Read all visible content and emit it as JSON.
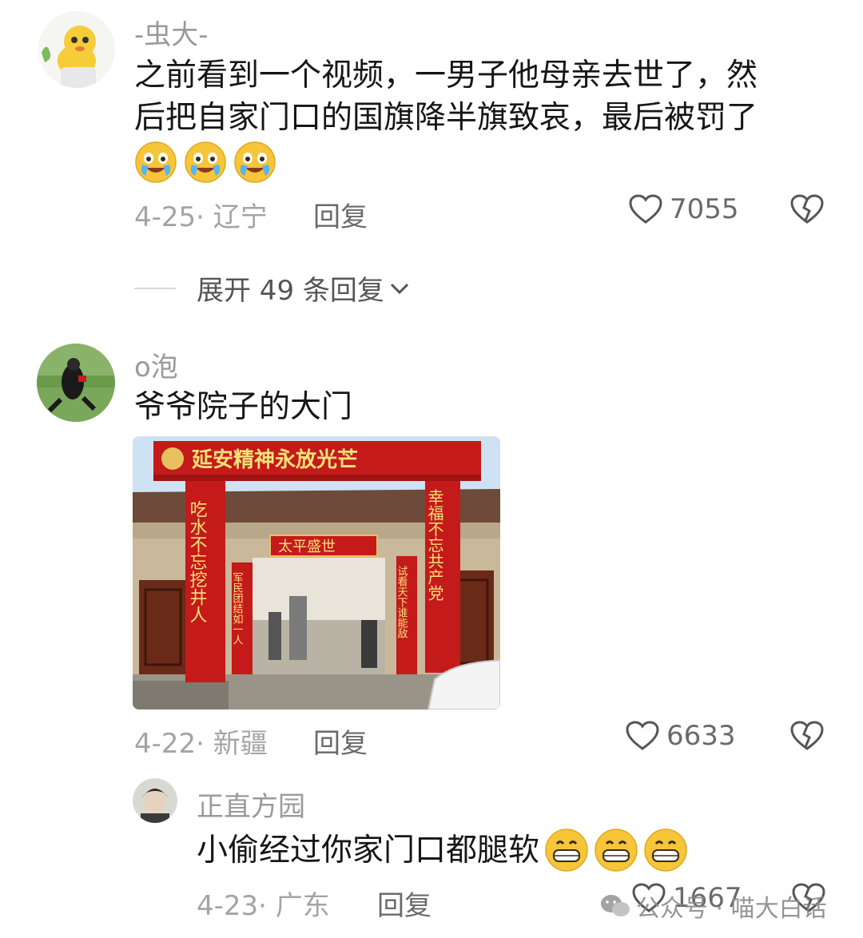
{
  "comments": [
    {
      "username": "-虫大-",
      "text_line1": "之前看到一个视频，一男子他母亲去世了，然",
      "text_line2": "后把自家门口的国旗降半旗致哀，最后被罚了",
      "emojis": [
        "crying-laughing",
        "crying-laughing",
        "crying-laughing"
      ],
      "date_location": "4-25· 辽宁",
      "reply_label": "回复",
      "likes": "7055",
      "expand_label": "展开 49 条回复"
    },
    {
      "username": "o泡",
      "text": "爷爷院子的大门",
      "date_location": "4-22· 新疆",
      "reply_label": "回复",
      "likes": "6633",
      "photo": {
        "banner": "延安精神永放光芒",
        "left_couplet": "吃水不忘挖井人",
        "right_couplet": "幸福不忘共产党",
        "plaque": "太平盛世",
        "inner_left": "军民团结如一人",
        "inner_right": "试看天下谁能敌"
      }
    },
    {
      "username": "正直方园",
      "text": "小偷经过你家门口都腿软",
      "emojis": [
        "grinning",
        "grinning",
        "grinning"
      ],
      "date_location": "4-23· 广东",
      "reply_label": "回复",
      "likes": "1667"
    }
  ],
  "watermark": "公众号 · 喵大白话",
  "colors": {
    "text": "#161616",
    "meta": "#a4a4a4",
    "red": "#c41a1a",
    "gold": "#f2c94c"
  }
}
